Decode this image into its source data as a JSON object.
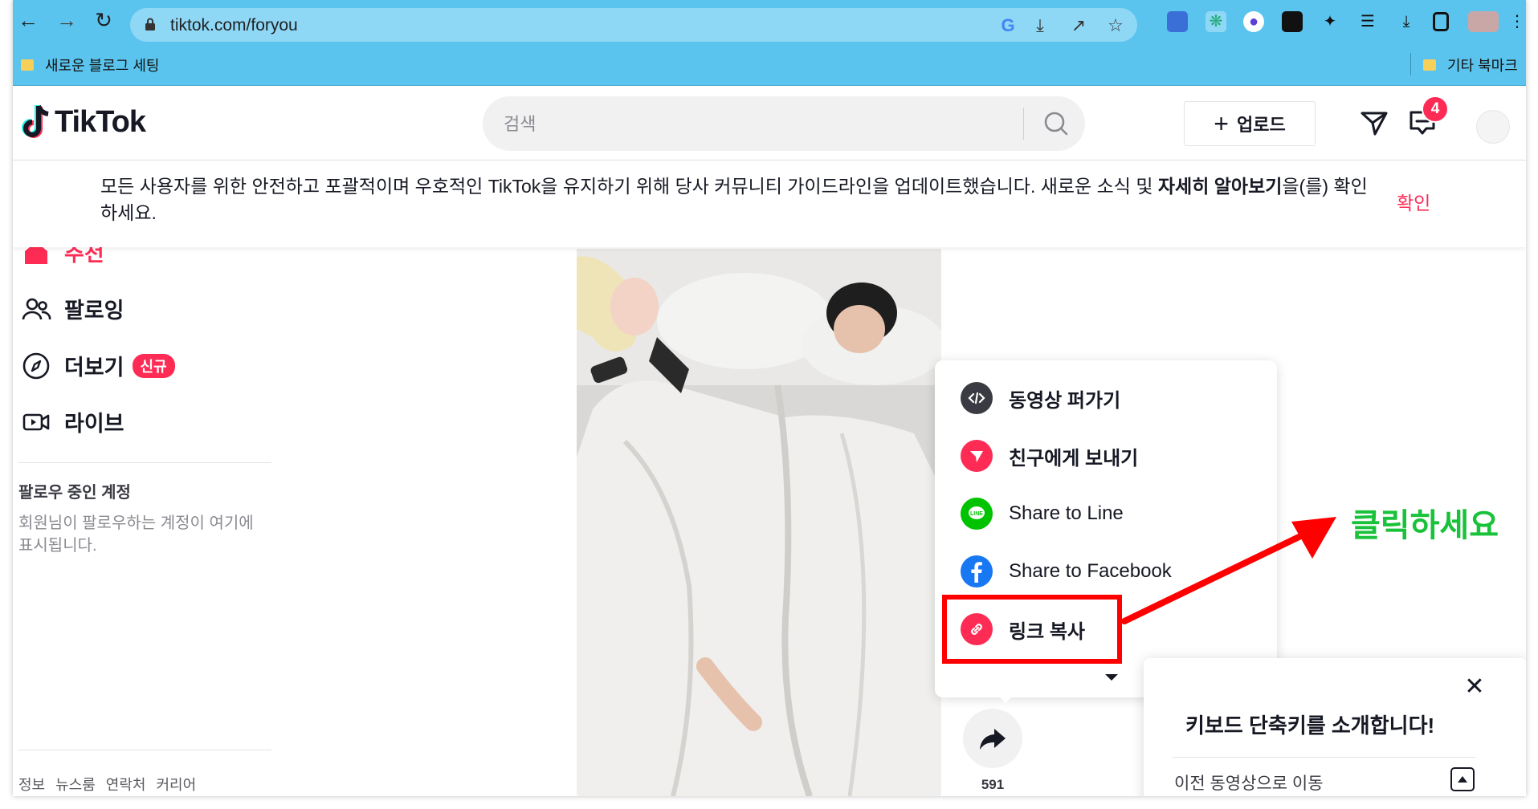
{
  "browser": {
    "url": "tiktok.com/foryou",
    "bookmarks": {
      "left": "새로운 블로그 세팅",
      "right": "기타 북마크"
    }
  },
  "header": {
    "logo": "TikTok",
    "search_placeholder": "검색",
    "upload_label": "업로드",
    "inbox_badge": "4"
  },
  "notice": {
    "text_before": "모든 사용자를 위한 안전하고 포괄적이며 우호적인 TikTok을 유지하기 위해 당사 커뮤니티 가이드라인을 업데이트했습니다. 새로운 소식 및 ",
    "bold_link": "자세히 알아보기",
    "text_after": "을(를) 확인하세요.",
    "confirm": "확인"
  },
  "sidebar": {
    "items": [
      {
        "label": "추천"
      },
      {
        "label": "팔로잉"
      },
      {
        "label": "더보기",
        "badge": "신규"
      },
      {
        "label": "라이브"
      }
    ],
    "following_heading": "팔로우 중인 계정",
    "following_desc": "회원님이 팔로우하는 계정이 여기에 표시됩니다.",
    "footer": "정보 뉴스룸 연락처 커리어"
  },
  "share_menu": {
    "items": [
      {
        "label": "동영상 퍼가기",
        "icon": "embed-icon",
        "color": "#3a3b42"
      },
      {
        "label": "친구에게 보내기",
        "icon": "send-icon",
        "color": "#fe2c55"
      },
      {
        "label": "Share to Line",
        "icon": "line-icon",
        "color": "#00c300"
      },
      {
        "label": "Share to Facebook",
        "icon": "facebook-icon",
        "color": "#1877f2"
      },
      {
        "label": "링크 복사",
        "icon": "link-icon",
        "color": "#fe2c55"
      }
    ]
  },
  "share": {
    "count": "591"
  },
  "annotation": {
    "text": "클릭하세요",
    "color": "#19c23a"
  },
  "keyboard_popup": {
    "title": "키보드 단축키를 소개합니다!",
    "row": "이전 동영상으로 이동"
  },
  "colors": {
    "brand": "#fe2c55",
    "chrome": "#5bc4ee"
  }
}
